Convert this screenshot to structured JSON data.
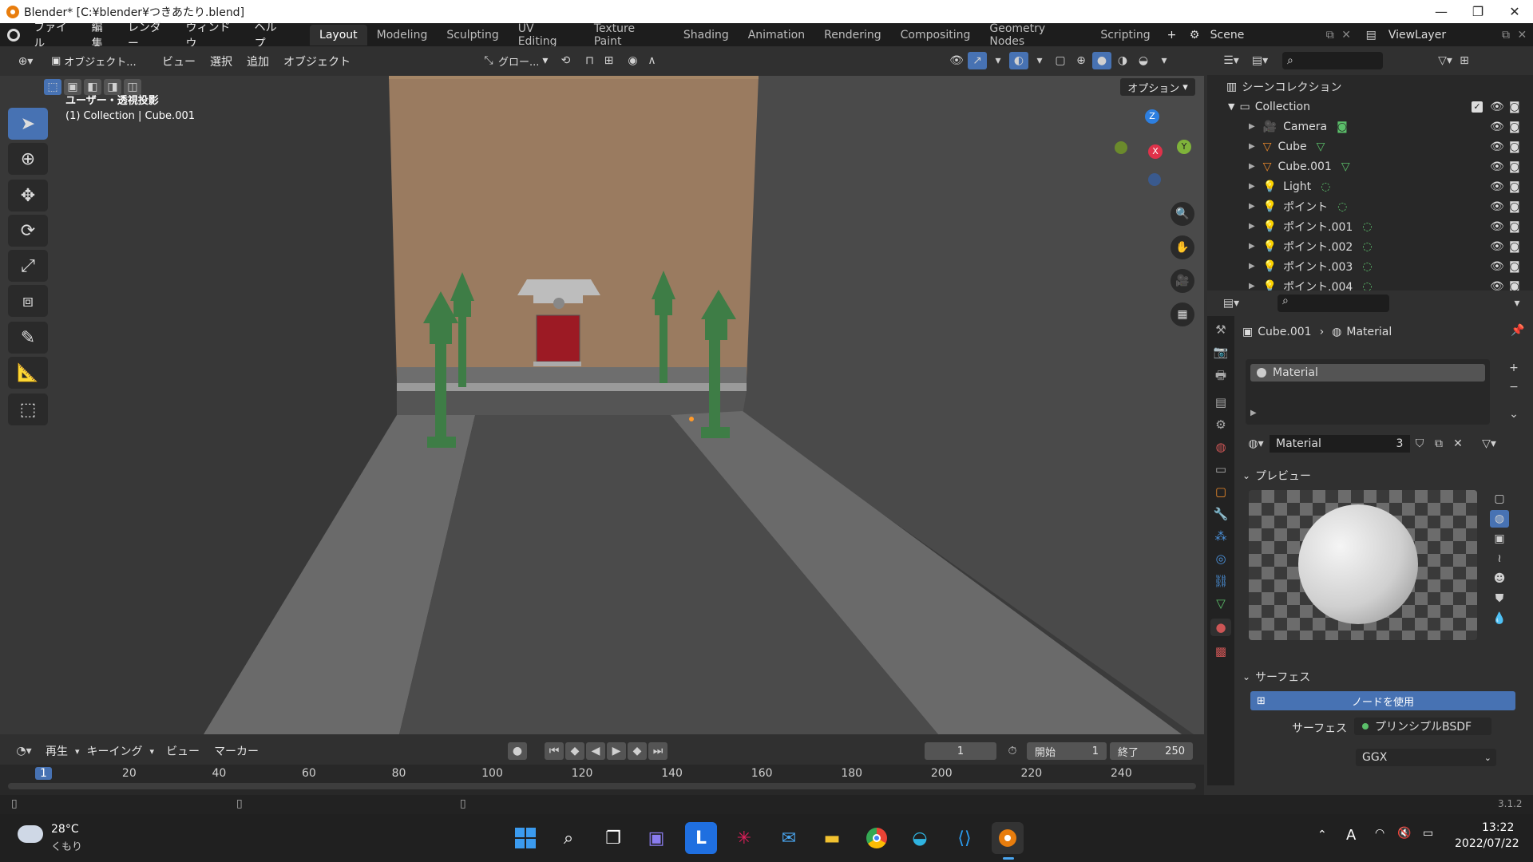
{
  "window": {
    "title": "Blender* [C:¥blender¥つきあたり.blend]",
    "minimize": "—",
    "maximize": "❐",
    "close": "✕"
  },
  "topbar": {
    "menus": [
      "ファイル",
      "編集",
      "レンダー",
      "ウィンドウ",
      "ヘルプ"
    ],
    "workspaces": [
      "Layout",
      "Modeling",
      "Sculpting",
      "UV Editing",
      "Texture Paint",
      "Shading",
      "Animation",
      "Rendering",
      "Compositing",
      "Geometry Nodes",
      "Scripting"
    ],
    "active_workspace": "Layout",
    "add_tab": "+",
    "scene_label": "Scene",
    "viewlayer_label": "ViewLayer"
  },
  "viewport_header": {
    "mode": "オブジェクト...",
    "menus": [
      "ビュー",
      "選択",
      "追加",
      "オブジェクト"
    ],
    "transform_orientation": "グロー...",
    "options": "オプション"
  },
  "viewport": {
    "view_name": "ユーザー・透視投影",
    "context": "(1) Collection | Cube.001",
    "gizmo": {
      "x": "X",
      "y": "Y",
      "z": "Z"
    }
  },
  "outliner": {
    "root": "シーンコレクション",
    "collection": "Collection",
    "items": [
      {
        "name": "Camera",
        "icon": "camera-icon"
      },
      {
        "name": "Cube",
        "icon": "mesh-icon"
      },
      {
        "name": "Cube.001",
        "icon": "mesh-icon"
      },
      {
        "name": "Light",
        "icon": "light-icon"
      },
      {
        "name": "ポイント",
        "icon": "light-icon"
      },
      {
        "name": "ポイント.001",
        "icon": "light-icon"
      },
      {
        "name": "ポイント.002",
        "icon": "light-icon"
      },
      {
        "name": "ポイント.003",
        "icon": "light-icon"
      },
      {
        "name": "ポイント.004",
        "icon": "light-icon"
      }
    ]
  },
  "properties": {
    "breadcrumb_object": "Cube.001",
    "breadcrumb_sep": "›",
    "breadcrumb_material": "Material",
    "slot_name": "Material",
    "material_name": "Material",
    "users": "3",
    "preview_header": "プレビュー",
    "surface_header": "サーフェス",
    "use_nodes": "ノードを使用",
    "surface_label": "サーフェス",
    "surface_value": "プリンシプルBSDF",
    "distribution": "GGX"
  },
  "timeline_header": {
    "menus": [
      "再生",
      "キーイング",
      "ビュー",
      "マーカー"
    ],
    "current_frame": "1",
    "start_label": "開始",
    "start": "1",
    "end_label": "終了",
    "end": "250"
  },
  "timeline": {
    "ticks": [
      "1",
      "20",
      "40",
      "60",
      "80",
      "100",
      "120",
      "140",
      "160",
      "180",
      "200",
      "220",
      "240"
    ]
  },
  "statusbar": {
    "version": "3.1.2"
  },
  "taskbar": {
    "weather_temp": "28°C",
    "weather_desc": "くもり",
    "time": "13:22",
    "date": "2022/07/22",
    "ime": "A"
  },
  "colors": {
    "accent": "#4772b3",
    "header": "#303030",
    "panel": "#282828",
    "blender_orange": "#e87d0d"
  }
}
